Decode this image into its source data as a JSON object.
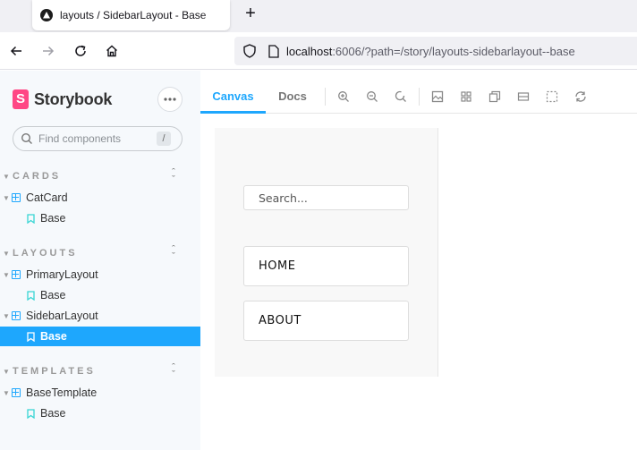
{
  "browser": {
    "tab_title": "layouts / SidebarLayout - Base",
    "new_tab_label": "+",
    "url_host": "localhost",
    "url_rest": ":6006/?path=/story/layouts-sidebarlayout--base"
  },
  "storybook": {
    "brand": "Storybook",
    "brand_mark": "S",
    "search_placeholder": "Find components",
    "search_shortcut": "/",
    "groups": [
      {
        "label": "CARDS",
        "components": [
          {
            "name": "CatCard",
            "stories": [
              "Base"
            ]
          }
        ]
      },
      {
        "label": "LAYOUTS",
        "components": [
          {
            "name": "PrimaryLayout",
            "stories": [
              "Base"
            ]
          },
          {
            "name": "SidebarLayout",
            "stories": [
              "Base"
            ]
          }
        ]
      },
      {
        "label": "TEMPLATES",
        "components": [
          {
            "name": "BaseTemplate",
            "stories": [
              "Base"
            ]
          }
        ]
      }
    ],
    "selected_story": "layouts / SidebarLayout / Base"
  },
  "toolbar": {
    "tabs": [
      "Canvas",
      "Docs"
    ],
    "active_tab": "Canvas",
    "icons": [
      "zoom-in-icon",
      "zoom-out-icon",
      "zoom-reset-icon",
      "background-icon",
      "grid-icon",
      "viewport-icon",
      "measure-icon",
      "outline-icon",
      "remount-icon"
    ]
  },
  "preview": {
    "search_placeholder": "Search...",
    "nav": [
      "HOME",
      "ABOUT"
    ]
  },
  "colors": {
    "accent": "#1ea7fd",
    "brand": "#ff4785",
    "sidebar_bg": "#f6f9fc"
  }
}
